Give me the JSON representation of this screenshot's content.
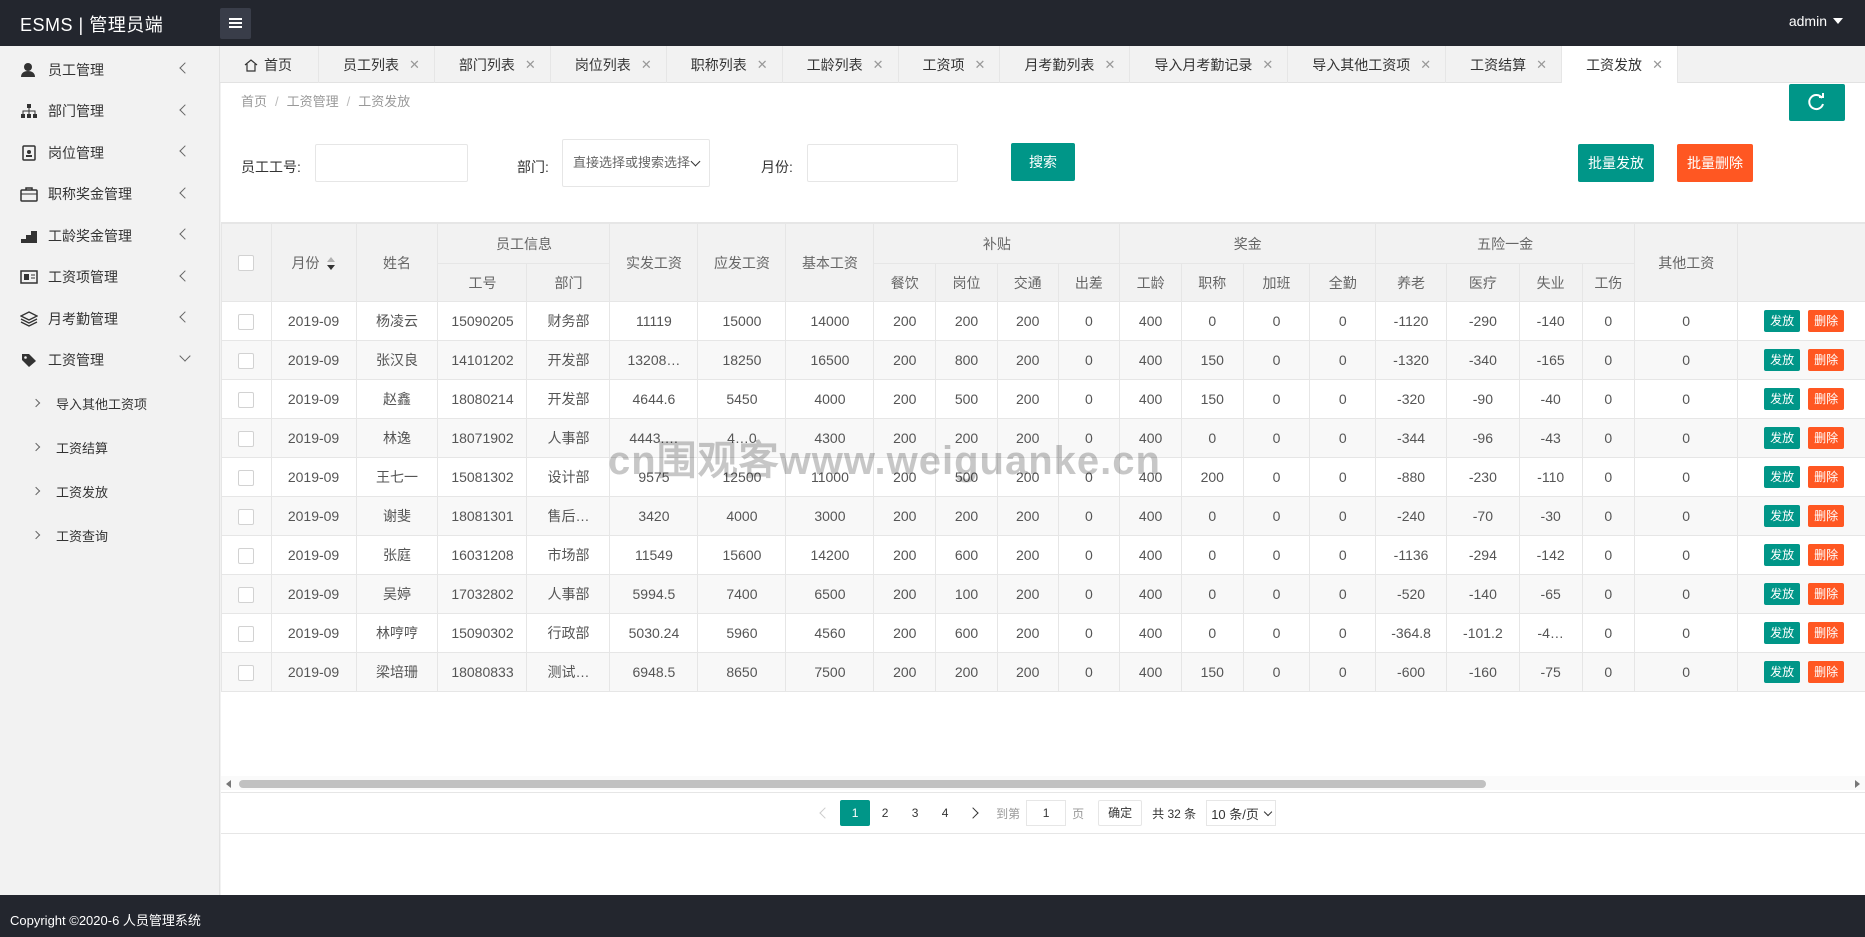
{
  "app": {
    "title": "ESMS | 管理员端",
    "user": "admin"
  },
  "sidebar": {
    "items": [
      {
        "label": "员工管理",
        "icon": "user-icon"
      },
      {
        "label": "部门管理",
        "icon": "sitemap-icon"
      },
      {
        "label": "岗位管理",
        "icon": "badge-icon"
      },
      {
        "label": "职称奖金管理",
        "icon": "briefcase-icon"
      },
      {
        "label": "工龄奖金管理",
        "icon": "stairs-icon"
      },
      {
        "label": "工资项管理",
        "icon": "salary-item-icon"
      },
      {
        "label": "月考勤管理",
        "icon": "layers-icon"
      },
      {
        "label": "工资管理",
        "icon": "tag-icon"
      }
    ],
    "subitems": [
      {
        "label": "导入其他工资项"
      },
      {
        "label": "工资结算"
      },
      {
        "label": "工资发放"
      },
      {
        "label": "工资查询"
      }
    ]
  },
  "tabs": [
    {
      "label": "首页"
    },
    {
      "label": "员工列表"
    },
    {
      "label": "部门列表"
    },
    {
      "label": "岗位列表"
    },
    {
      "label": "职称列表"
    },
    {
      "label": "工龄列表"
    },
    {
      "label": "工资项"
    },
    {
      "label": "月考勤列表"
    },
    {
      "label": "导入月考勤记录"
    },
    {
      "label": "导入其他工资项"
    },
    {
      "label": "工资结算"
    },
    {
      "label": "工资发放"
    }
  ],
  "tab_close": "✕",
  "breadcrumb": {
    "home": "首页",
    "parent": "工资管理",
    "current": "工资发放",
    "sep": "/"
  },
  "search": {
    "emp_label": "员工工号:",
    "dept_label": "部门:",
    "dept_placeholder": "直接选择或搜索选择",
    "month_label": "月份:",
    "search_btn": "搜索",
    "batch_issue": "批量发放",
    "batch_delete": "批量删除"
  },
  "table": {
    "h_month": "月份",
    "h_name": "姓名",
    "h_emp_info": "员工信息",
    "h_emp_no": "工号",
    "h_dept": "部门",
    "h_actual": "实发工资",
    "h_payable": "应发工资",
    "h_base": "基本工资",
    "h_subsidy": "补贴",
    "h_meal": "餐饮",
    "h_post": "岗位",
    "h_traffic": "交通",
    "h_trip": "出差",
    "h_bonus": "奖金",
    "h_seniority": "工龄",
    "h_title": "职称",
    "h_overtime": "加班",
    "h_attendance": "全勤",
    "h_insurance": "五险一金",
    "h_pension": "养老",
    "h_medical": "医疗",
    "h_unemp": "失业",
    "h_injury": "工伤",
    "h_other": "其他工资",
    "btn_issue": "发放",
    "btn_delete": "删除",
    "rows": [
      [
        "2019-09",
        "杨凌云",
        "15090205",
        "财务部",
        "11119",
        "15000",
        "14000",
        "200",
        "200",
        "200",
        "0",
        "400",
        "0",
        "0",
        "0",
        "-1120",
        "-290",
        "-140",
        "0",
        "0"
      ],
      [
        "2019-09",
        "张汉良",
        "14101202",
        "开发部",
        "13208…",
        "18250",
        "16500",
        "200",
        "800",
        "200",
        "0",
        "400",
        "150",
        "0",
        "0",
        "-1320",
        "-340",
        "-165",
        "0",
        "0"
      ],
      [
        "2019-09",
        "赵鑫",
        "18080214",
        "开发部",
        "4644.6",
        "5450",
        "4000",
        "200",
        "500",
        "200",
        "0",
        "400",
        "150",
        "0",
        "0",
        "-320",
        "-90",
        "-40",
        "0",
        "0"
      ],
      [
        "2019-09",
        "林逸",
        "18071902",
        "人事部",
        "4443.…",
        "4…0",
        "4300",
        "200",
        "200",
        "200",
        "0",
        "400",
        "0",
        "0",
        "0",
        "-344",
        "-96",
        "-43",
        "0",
        "0"
      ],
      [
        "2019-09",
        "王七一",
        "15081302",
        "设计部",
        "9575",
        "12500",
        "11000",
        "200",
        "500",
        "200",
        "0",
        "400",
        "200",
        "0",
        "0",
        "-880",
        "-230",
        "-110",
        "0",
        "0"
      ],
      [
        "2019-09",
        "谢斐",
        "18081301",
        "售后…",
        "3420",
        "4000",
        "3000",
        "200",
        "200",
        "200",
        "0",
        "400",
        "0",
        "0",
        "0",
        "-240",
        "-70",
        "-30",
        "0",
        "0"
      ],
      [
        "2019-09",
        "张庭",
        "16031208",
        "市场部",
        "11549",
        "15600",
        "14200",
        "200",
        "600",
        "200",
        "0",
        "400",
        "0",
        "0",
        "0",
        "-1136",
        "-294",
        "-142",
        "0",
        "0"
      ],
      [
        "2019-09",
        "吴婷",
        "17032802",
        "人事部",
        "5994.5",
        "7400",
        "6500",
        "200",
        "100",
        "200",
        "0",
        "400",
        "0",
        "0",
        "0",
        "-520",
        "-140",
        "-65",
        "0",
        "0"
      ],
      [
        "2019-09",
        "林哼哼",
        "15090302",
        "行政部",
        "5030.24",
        "5960",
        "4560",
        "200",
        "600",
        "200",
        "0",
        "400",
        "0",
        "0",
        "0",
        "-364.8",
        "-101.2",
        "-4…",
        "0",
        "0"
      ],
      [
        "2019-09",
        "梁培珊",
        "18080833",
        "测试…",
        "6948.5",
        "8650",
        "7500",
        "200",
        "200",
        "200",
        "0",
        "400",
        "150",
        "0",
        "0",
        "-600",
        "-160",
        "-75",
        "0",
        "0"
      ]
    ]
  },
  "pager": {
    "pages": [
      "1",
      "2",
      "3",
      "4"
    ],
    "current": "1",
    "goto_label": "到第",
    "goto_value": "1",
    "page_unit": "页",
    "confirm": "确定",
    "total": "共 32 条",
    "page_size": "10 条/页"
  },
  "watermark": "cn围观客www.weiguanke.cn",
  "footer": "Copyright ©2020-6 人员管理系统",
  "colors": {
    "primary": "#009688",
    "danger": "#ff5722",
    "dark": "#23262e"
  }
}
